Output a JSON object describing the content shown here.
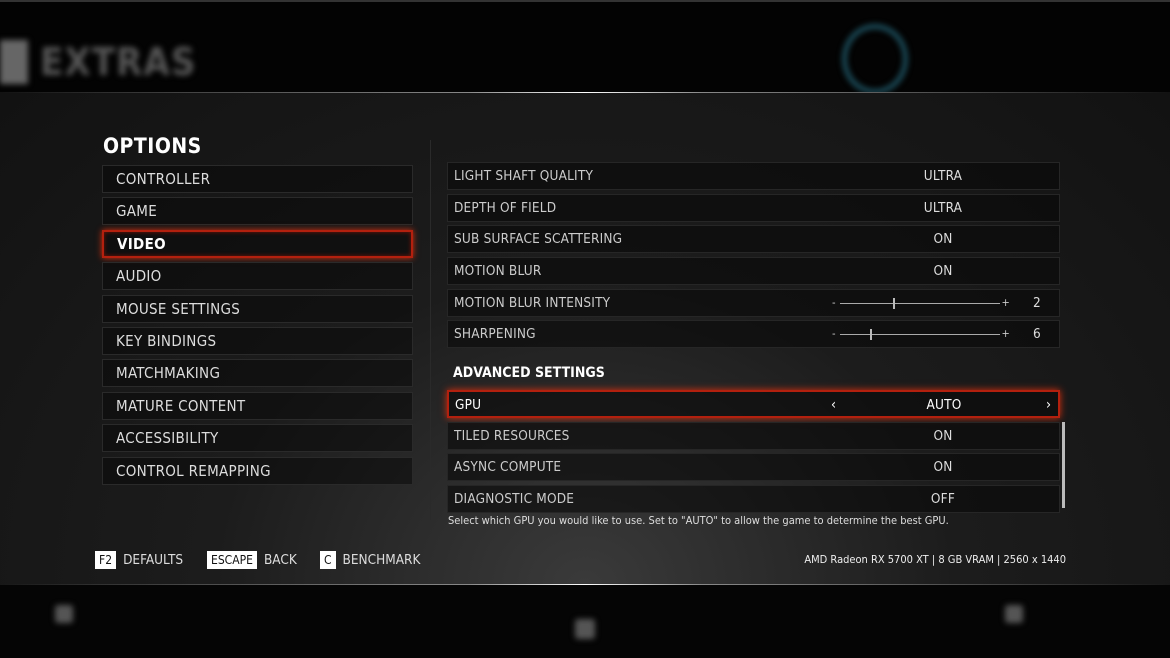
{
  "background_header": {
    "title": "EXTRAS"
  },
  "options": {
    "title": "OPTIONS",
    "menu": [
      {
        "label": "CONTROLLER"
      },
      {
        "label": "GAME"
      },
      {
        "label": "VIDEO",
        "selected": true
      },
      {
        "label": "AUDIO"
      },
      {
        "label": "MOUSE SETTINGS"
      },
      {
        "label": "KEY BINDINGS"
      },
      {
        "label": "MATCHMAKING"
      },
      {
        "label": "MATURE CONTENT"
      },
      {
        "label": "ACCESSIBILITY"
      },
      {
        "label": "CONTROL REMAPPING"
      }
    ]
  },
  "settings": [
    {
      "label": "LIGHT SHAFT QUALITY",
      "value": "ULTRA"
    },
    {
      "label": "DEPTH OF FIELD",
      "value": "ULTRA"
    },
    {
      "label": "SUB SURFACE SCATTERING",
      "value": "ON"
    },
    {
      "label": "MOTION BLUR",
      "value": "ON"
    },
    {
      "label": "MOTION BLUR INTENSITY",
      "value": "2",
      "slider_fraction": 0.33
    },
    {
      "label": "SHARPENING",
      "value": "6",
      "slider_fraction": 0.19
    }
  ],
  "advanced": {
    "title": "ADVANCED SETTINGS",
    "rows": [
      {
        "label": "GPU",
        "value": "AUTO",
        "selected": true
      },
      {
        "label": "TILED RESOURCES",
        "value": "ON"
      },
      {
        "label": "ASYNC COMPUTE",
        "value": "ON"
      },
      {
        "label": "DIAGNOSTIC MODE",
        "value": "OFF"
      }
    ]
  },
  "description": "Select which GPU you would like to use. Set to \"AUTO\" to allow the game to determine the best GPU.",
  "footer": {
    "actions": [
      {
        "key": "F2",
        "label": "DEFAULTS"
      },
      {
        "key": "ESCAPE",
        "label": "BACK"
      },
      {
        "key": "C",
        "label": "BENCHMARK"
      }
    ],
    "hardware": "AMD Radeon RX 5700 XT | 8 GB VRAM | 2560 x 1440"
  },
  "colors": {
    "accent": "#b3200e",
    "panel": "#1c1c1c"
  }
}
